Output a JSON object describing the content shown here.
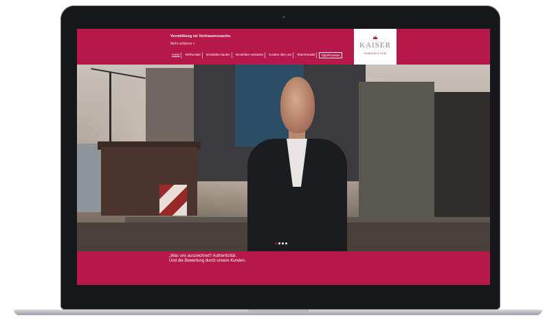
{
  "header": {
    "tagline": "Vermittlung ist Vertrauenssache.",
    "more_link": "Mehr erfahren »"
  },
  "nav": {
    "items": [
      {
        "label": "Home",
        "active": true
      },
      {
        "label": "Wir/Kontakt"
      },
      {
        "label": "Immobilien kaufen"
      },
      {
        "label": "Immobilien verkaufen"
      },
      {
        "label": "Kunden über uns"
      },
      {
        "label": "Team/Kontakt"
      },
      {
        "label": "Tipp/Provision",
        "outlined": true
      }
    ]
  },
  "logo": {
    "name": "KAISER",
    "sub": "IMMOBILIEN"
  },
  "slider": {
    "count": 4,
    "active_index": 0
  },
  "hero_text": {
    "line1": "„Was uns auszeichnet? Authentizität.",
    "line2": "Und die Bewertung durch unsere Kunden."
  },
  "colors": {
    "brand": "#b6184a"
  }
}
